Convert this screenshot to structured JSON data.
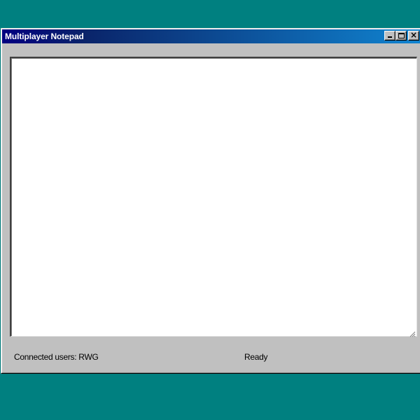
{
  "window": {
    "title": "Multiplayer Notepad",
    "controls": {
      "minimize": "minimize-icon",
      "maximize": "maximize-icon",
      "close": "close-icon"
    }
  },
  "editor": {
    "value": ""
  },
  "status_bar": {
    "connected_users": "Connected users: RWG",
    "state": "Ready"
  },
  "colors": {
    "desktop": "#008080",
    "title_bar_start": "#000080",
    "title_bar_end": "#1084d0",
    "window_face": "#c0c0c0",
    "editor_background": "#ffffff"
  }
}
